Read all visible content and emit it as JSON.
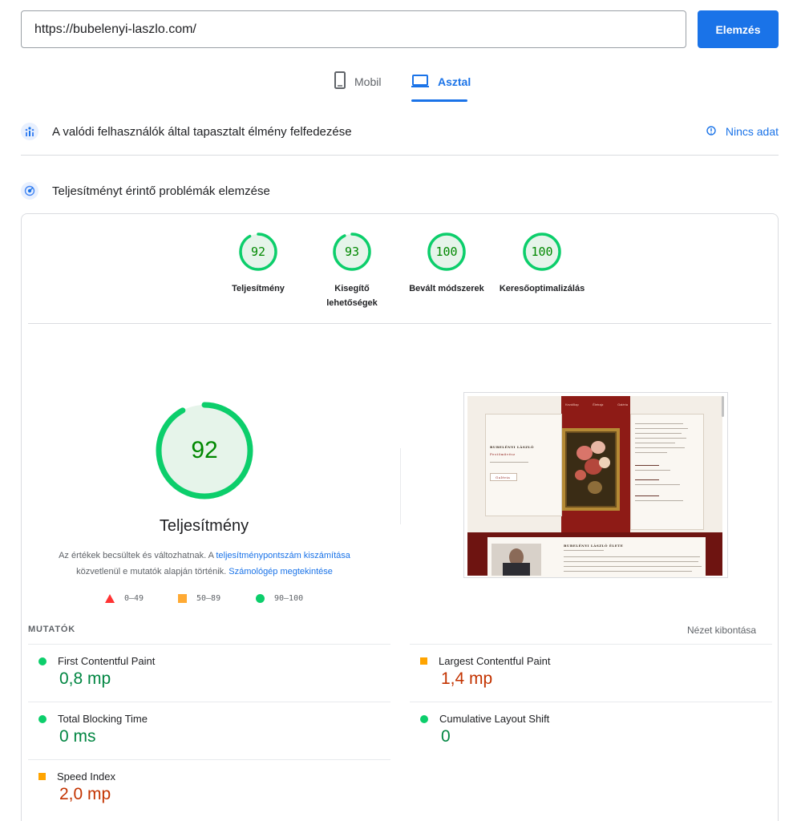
{
  "url_input": {
    "value": "https://bubelenyi-laszlo.com/"
  },
  "analyze_button": {
    "label": "Elemzés"
  },
  "tabs": {
    "mobile": "Mobil",
    "desktop": "Asztal"
  },
  "field_data": {
    "title": "A valódi felhasználók által tapasztalt élmény felfedezése",
    "no_data": "Nincs adat"
  },
  "lab_section": {
    "title": "Teljesítményt érintő problémák elemzése"
  },
  "categories": [
    {
      "score": "92",
      "label": "Teljesítmény",
      "value": 92
    },
    {
      "score": "93",
      "label": "Kisegítő lehetőségek",
      "value": 93
    },
    {
      "score": "100",
      "label": "Bevált módszerek",
      "value": 100
    },
    {
      "score": "100",
      "label": "Keresőoptimalizálás",
      "value": 100
    }
  ],
  "performance": {
    "score": "92",
    "value": 92,
    "title": "Teljesítmény",
    "desc_part1": "Az értékek becsültek és változhatnak. A ",
    "desc_link1": "teljesítménypontszám kiszámítása",
    "desc_part2": " közvetlenül e mutatók alapján történik. ",
    "desc_link2": "Számológép megtekintése"
  },
  "legend": {
    "poor": "0–49",
    "average": "50–89",
    "good": "90–100"
  },
  "screenshot": {
    "nav": [
      "Kezdőlap",
      "Életrajz",
      "Galéria"
    ],
    "site_title": "BUBELÉNYI LÁSZLÓ",
    "site_subtitle": "Festőművész",
    "button": "Galéria",
    "bio_title": "BUBELÉNYI LÁSZLÓ ÉLETE"
  },
  "metrics": {
    "header": "MUTATÓK",
    "expand": "Nézet kibontása",
    "items": [
      {
        "name": "First Contentful Paint",
        "value": "0,8 mp",
        "rating": "good"
      },
      {
        "name": "Largest Contentful Paint",
        "value": "1,4 mp",
        "rating": "average"
      },
      {
        "name": "Total Blocking Time",
        "value": "0 ms",
        "rating": "good"
      },
      {
        "name": "Cumulative Layout Shift",
        "value": "0",
        "rating": "good"
      },
      {
        "name": "Speed Index",
        "value": "2,0 mp",
        "rating": "average"
      }
    ]
  },
  "colors": {
    "accent": "#1a73e8",
    "good": "#0cce6b",
    "good_text": "#008800",
    "average": "#ffa400",
    "poor": "#ff3333"
  }
}
